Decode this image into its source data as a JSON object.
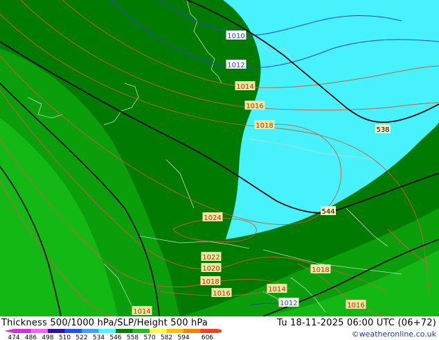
{
  "map": {
    "isobar_labels": [
      {
        "text": "1010",
        "color": "#1f3fd0"
      },
      {
        "text": "1012",
        "color": "#1f3fd0"
      },
      {
        "text": "1014",
        "color": "#b03010"
      },
      {
        "text": "1016",
        "color": "#b03010"
      },
      {
        "text": "1018",
        "color": "#b03010"
      },
      {
        "text": "1024",
        "color": "#b03010"
      },
      {
        "text": "1022",
        "color": "#b03010"
      },
      {
        "text": "1020",
        "color": "#b03010"
      },
      {
        "text": "1018",
        "color": "#b03010"
      },
      {
        "text": "1016",
        "color": "#b03010"
      },
      {
        "text": "1014",
        "color": "#b03010"
      },
      {
        "text": "1012",
        "color": "#1f3fd0"
      },
      {
        "text": "1018",
        "color": "#b03010"
      },
      {
        "text": "1016",
        "color": "#b03010"
      },
      {
        "text": "1014",
        "color": "#b03010"
      }
    ],
    "thickness_labels": [
      {
        "text": "538"
      },
      {
        "text": "544"
      }
    ],
    "colors": {
      "cyan": "#48f2fc",
      "dark_green": "#007a00",
      "mid_green": "#0a9e0a",
      "light_green": "#14b814",
      "isobar_red": "#d05a3a",
      "isobar_blue": "#3040d0",
      "border": "#b8c8b8"
    }
  },
  "footer": {
    "title": "Thickness 500/1000 hPa/SLP/Height 500 hPa",
    "valid_time": "Tu 18-11-2025 06:00 UTC (06+72)",
    "credit": "©weatheronline.co.uk",
    "scale": {
      "ticks": [
        "474",
        "486",
        "498",
        "510",
        "522",
        "534",
        "546",
        "558",
        "570",
        "582",
        "594",
        "606"
      ],
      "colors": [
        "#d030e0",
        "#ff60ff",
        "#3010a0",
        "#2050ff",
        "#40a0ff",
        "#40ffff",
        "#008000",
        "#20c020",
        "#ffff40",
        "#ffc000",
        "#ff8000",
        "#ff4020"
      ]
    }
  }
}
